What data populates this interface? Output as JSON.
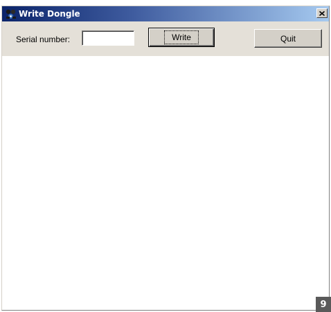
{
  "window": {
    "title": "Write Dongle",
    "app_icon": "dongle-app-icon",
    "close_icon": "close-icon",
    "close_symbol": "✕"
  },
  "toolbar": {
    "serial_label": "Serial number:",
    "serial_value": "",
    "serial_placeholder": "",
    "write_label": "Write",
    "quit_label": "Quit"
  },
  "page_number": "9",
  "colors": {
    "titlebar_start": "#0b246a",
    "titlebar_end": "#a6caf0",
    "dialog_face": "#e4e0d8",
    "page_badge": "#5a5a5a"
  }
}
